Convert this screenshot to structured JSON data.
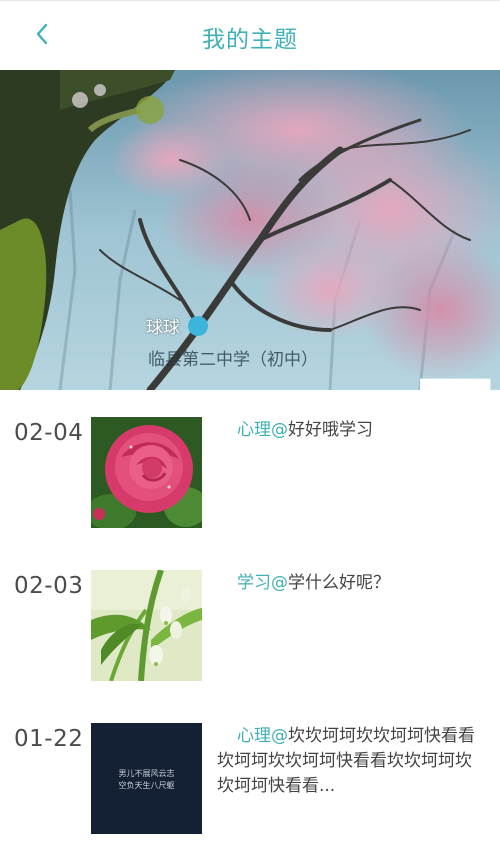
{
  "header": {
    "title": "我的主题",
    "back_icon": "chevron-left-icon"
  },
  "profile": {
    "user_name": "球球",
    "gender_icon": "male-icon",
    "school": "临县第二中学（初中）"
  },
  "posts": [
    {
      "date": "02-04",
      "tag": "心理@",
      "content": "好好哦学习",
      "thumbnail": "pink-rose-photo"
    },
    {
      "date": "02-03",
      "tag": "学习@",
      "content": "学什么好呢？",
      "thumbnail": "green-flower-photo"
    },
    {
      "date": "01-22",
      "tag": "心理@",
      "content": "坎坎坷坷坎坎坷坷快看看坎坷坷坎坎坷坷快看看坎坎坷坷坎坎坷坷快看看...",
      "thumbnail": "dark-text-image",
      "thumbnail_text_1": "男儿不展风云志",
      "thumbnail_text_2": "空负天生八尺躯"
    }
  ],
  "colors": {
    "accent": "#3fb0b6",
    "date_text": "#4b4b4b",
    "body_text": "#444444"
  }
}
